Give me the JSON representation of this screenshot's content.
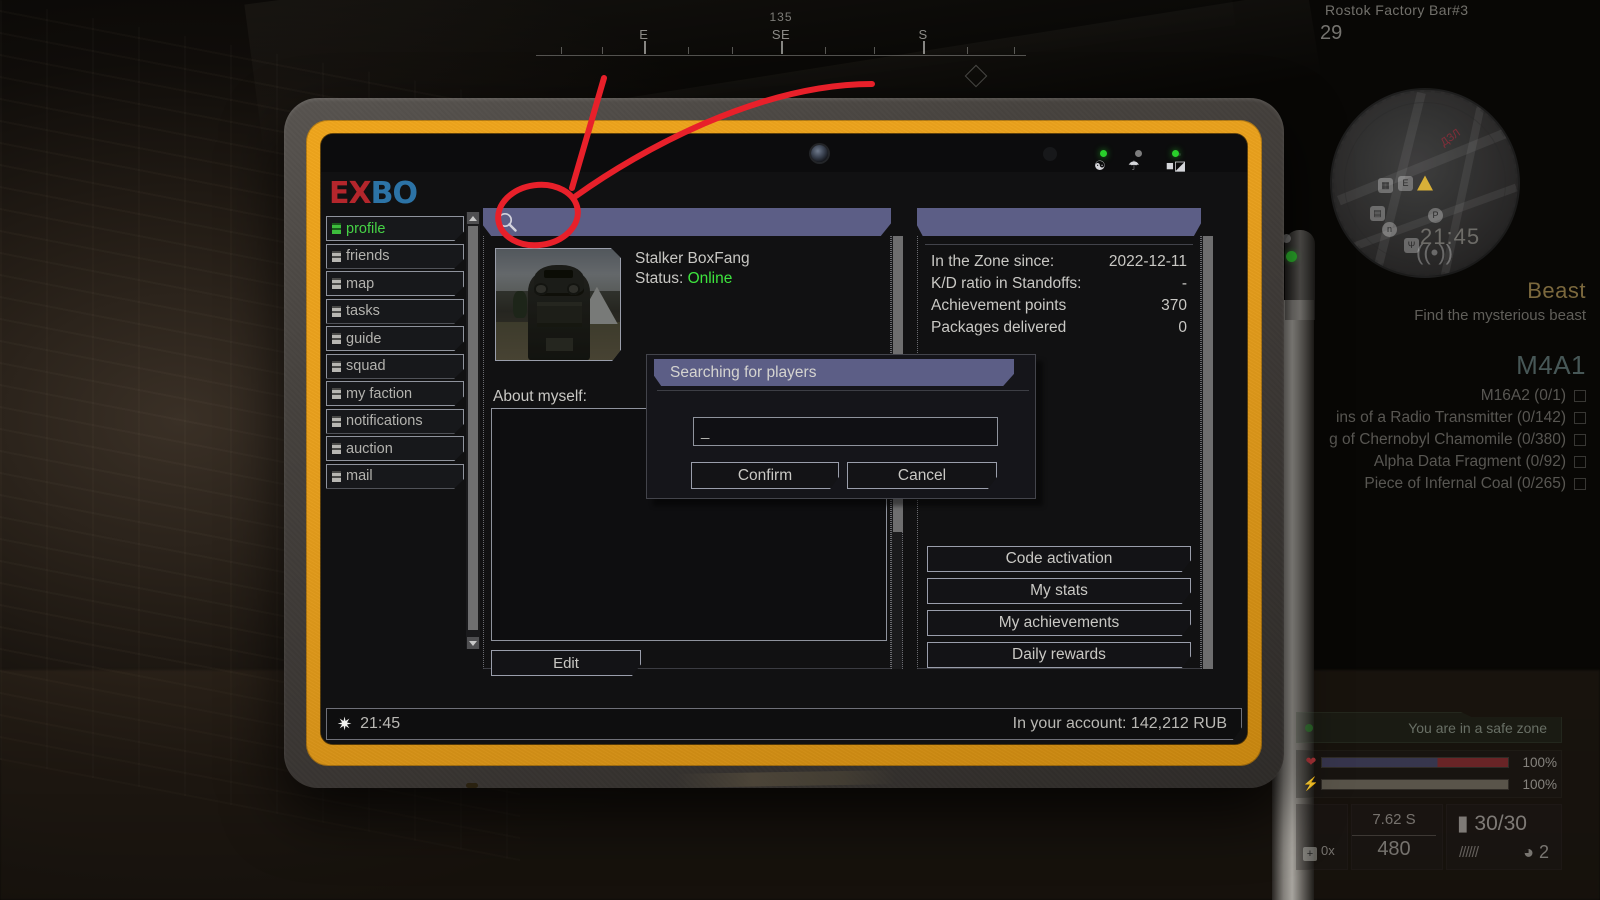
{
  "game_hud": {
    "compass": {
      "heading": "135",
      "labels": [
        {
          "text": "E",
          "pos": 22
        },
        {
          "text": "SE",
          "pos": 50
        },
        {
          "text": "S",
          "pos": 79
        }
      ]
    },
    "location_name": "Rostok Factory Bar#3",
    "location_count": "29",
    "clock": "21:45",
    "task": {
      "title": "Beast",
      "subtitle": "Find the mysterious beast"
    },
    "weapon": {
      "name": "M4A1"
    },
    "objectives": [
      "M16A2 (0/1)",
      "ins of a Radio Transmitter (0/142)",
      "g of Chernobyl Chamomile (0/380)",
      "Alpha Data Fragment (0/92)",
      "Piece of Infernal Coal (0/265)"
    ],
    "safe_zone_text": "You are in a safe zone",
    "vitals": [
      {
        "icon": "heart-icon",
        "value": "100%"
      },
      {
        "icon": "stamina-icon",
        "value": "100%"
      }
    ],
    "ammo": {
      "medkit_count": "0x",
      "caliber": "7.62 S",
      "reserve": "480",
      "magazine": "30/30",
      "grenades": "2"
    }
  },
  "tablet": {
    "status_icons": {
      "antenna": "antenna-icon",
      "wifi": "wifi-icon",
      "battery": "battery-icon"
    },
    "logo": {
      "part1": "E",
      "part2": "X",
      "part3": "BO"
    },
    "nav": {
      "items": [
        {
          "label": "profile",
          "active": true
        },
        {
          "label": "friends",
          "active": false
        },
        {
          "label": "map",
          "active": false
        },
        {
          "label": "tasks",
          "active": false
        },
        {
          "label": "guide",
          "active": false
        },
        {
          "label": "squad",
          "active": false
        },
        {
          "label": "my faction",
          "active": false
        },
        {
          "label": "notifications",
          "active": false
        },
        {
          "label": "auction",
          "active": false
        },
        {
          "label": "mail",
          "active": false
        }
      ]
    },
    "profile": {
      "search_icon": "search-icon",
      "name": "Stalker BoxFang",
      "status_label": "Status:",
      "status_value": "Online",
      "about_label": "About myself:",
      "about_text": "",
      "edit_label": "Edit"
    },
    "stats": {
      "rows": [
        {
          "label": "In the Zone since:",
          "value": "2022-12-11"
        },
        {
          "label": "K/D ratio in Standoffs:",
          "value": "-"
        },
        {
          "label": "Achievement points",
          "value": "370"
        },
        {
          "label": "Packages delivered",
          "value": "0"
        }
      ],
      "buttons": [
        "Code activation",
        "My stats",
        "My achievements",
        "Daily rewards"
      ]
    },
    "modal": {
      "title": "Searching for players",
      "input_value": "",
      "input_caret": "_",
      "confirm_label": "Confirm",
      "cancel_label": "Cancel"
    },
    "bottom_bar": {
      "time": "21:45",
      "account": "In your account: 142,212 RUB"
    }
  },
  "colors": {
    "accent_header": "#5c5e86",
    "online_green": "#3ee43e",
    "tablet_frame": "#e8a01d",
    "annotation_red": "#e8202a",
    "logo_red": "#b4262c",
    "logo_blue": "#2c73a6"
  }
}
